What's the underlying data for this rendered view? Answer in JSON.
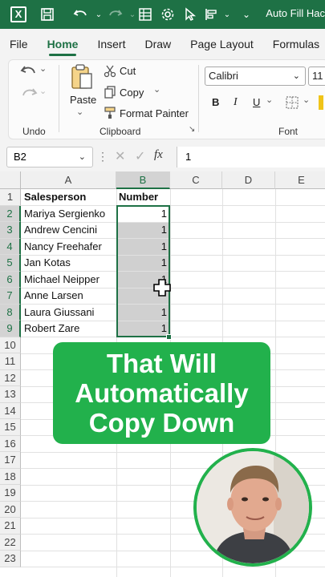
{
  "titlebar": {
    "title": "Auto Fill Hac",
    "app_icon": "X"
  },
  "ribbon_tabs": [
    "File",
    "Home",
    "Insert",
    "Draw",
    "Page Layout",
    "Formulas"
  ],
  "active_tab": "Home",
  "clipboard": {
    "paste": "Paste",
    "cut": "Cut",
    "copy": "Copy",
    "format_painter": "Format Painter",
    "group_label": "Clipboard"
  },
  "undo": {
    "group_label": "Undo"
  },
  "font": {
    "name": "Calibri",
    "size": "11",
    "bold": "B",
    "italic": "I",
    "underline": "U",
    "group_label": "Font"
  },
  "formula_bar": {
    "name_box": "B2",
    "fx": "fx",
    "value": "1"
  },
  "columns": [
    "A",
    "B",
    "C",
    "D",
    "E"
  ],
  "selected_column": "B",
  "rows": [
    "1",
    "2",
    "3",
    "4",
    "5",
    "6",
    "7",
    "8",
    "9",
    "10",
    "11",
    "12",
    "13",
    "14",
    "15",
    "16",
    "17",
    "18",
    "19",
    "20",
    "21",
    "22",
    "23"
  ],
  "header_row": {
    "a": "Salesperson",
    "b": "Number"
  },
  "data_rows": [
    {
      "a": "Mariya Sergienko",
      "b": "1"
    },
    {
      "a": "Andrew Cencini",
      "b": "1"
    },
    {
      "a": "Nancy Freehafer",
      "b": "1"
    },
    {
      "a": "Jan Kotas",
      "b": "1"
    },
    {
      "a": "Michael Neipper",
      "b": "1"
    },
    {
      "a": "Anne Larsen",
      "b": ""
    },
    {
      "a": "Laura Giussani",
      "b": "1"
    },
    {
      "a": "Robert Zare",
      "b": "1"
    }
  ],
  "callout": {
    "line1": "That Will",
    "line2": "Automatically",
    "line3": "Copy Down"
  },
  "colors": {
    "excel_green": "#1e7145",
    "callout_green": "#22b14c"
  }
}
